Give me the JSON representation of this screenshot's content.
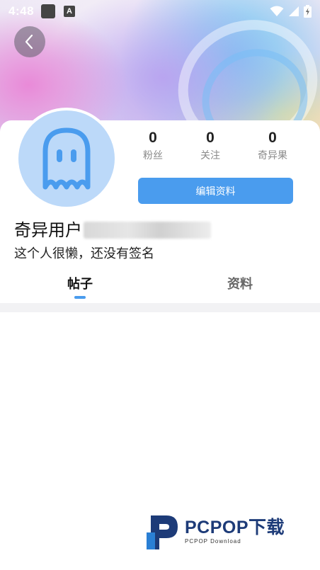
{
  "status_bar": {
    "time": "4:48",
    "notification_badge": "A",
    "icons": [
      "app-square-icon",
      "a-badge-icon",
      "wifi-icon",
      "signal-icon",
      "battery-charging-icon"
    ]
  },
  "header": {
    "back_icon": "chevron-left-icon"
  },
  "profile": {
    "avatar_icon": "ghost-icon",
    "username": "奇异用户",
    "signature": "这个人很懒，还没有签名",
    "edit_button_label": "编辑资料"
  },
  "stats": [
    {
      "value": "0",
      "label": "粉丝"
    },
    {
      "value": "0",
      "label": "关注"
    },
    {
      "value": "0",
      "label": "奇异果"
    }
  ],
  "tabs": [
    {
      "label": "帖子",
      "active": true
    },
    {
      "label": "资料",
      "active": false
    }
  ],
  "watermark": {
    "title": "PCPOP下载",
    "subtitle": "PCPOP Download"
  },
  "colors": {
    "accent": "#4a9cee",
    "avatar_bg": "#bcd9f9",
    "watermark_dark": "#1d3b78",
    "watermark_blue": "#2a7fd4"
  }
}
